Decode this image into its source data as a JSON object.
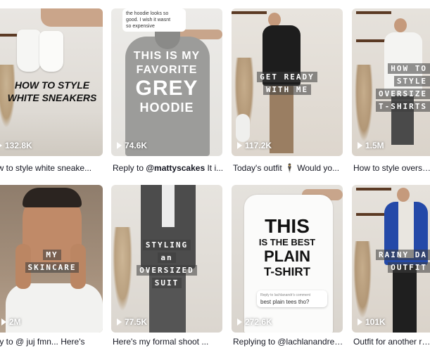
{
  "videos": [
    {
      "views": "132.8K",
      "caption": "ow to style white sneake...",
      "overlay": [
        "HOW TO STYLE",
        "WHITE SNEAKERS"
      ]
    },
    {
      "views": "74.6K",
      "caption_prefix": "Reply to ",
      "caption_mention": "@mattyscakes",
      "caption_rest": " It i...",
      "bubble": [
        "the hoodie looks so",
        "good. I wish it wasnt",
        "so expensive"
      ],
      "overlay": [
        "THIS IS MY",
        "FAVORITE",
        "GREY",
        "HOODIE"
      ]
    },
    {
      "views": "117.2K",
      "caption": "Today's outfit 🕴 Would yo...",
      "overlay": [
        "GET READY",
        "WITH ME"
      ]
    },
    {
      "views": "1.5M",
      "caption": "How to style oversize",
      "overlay": [
        "HOW TO",
        "STYLE",
        "OVERSIZE",
        "T-SHIRTS"
      ]
    },
    {
      "views": "2M",
      "caption": "nly to @ juj fmn... Here's",
      "overlay": [
        "MY",
        "SKINCARE"
      ]
    },
    {
      "views": "77.5K",
      "caption": "Here's my formal shoot ...",
      "overlay": [
        "STYLING",
        "an",
        "OVERSIZED",
        "SUIT"
      ]
    },
    {
      "views": "272.6K",
      "caption": "Replying to @lachlanandrews f...",
      "bubble": [
        "Reply to lachlanandr's comment",
        "best plain tees tho?"
      ],
      "overlay": [
        "THIS",
        "IS THE BEST",
        "PLAIN",
        "T-SHIRT"
      ]
    },
    {
      "views": "101K",
      "caption": "Outfit for another rai...",
      "overlay": [
        "RAINY DA",
        "OUTFIT"
      ]
    }
  ]
}
